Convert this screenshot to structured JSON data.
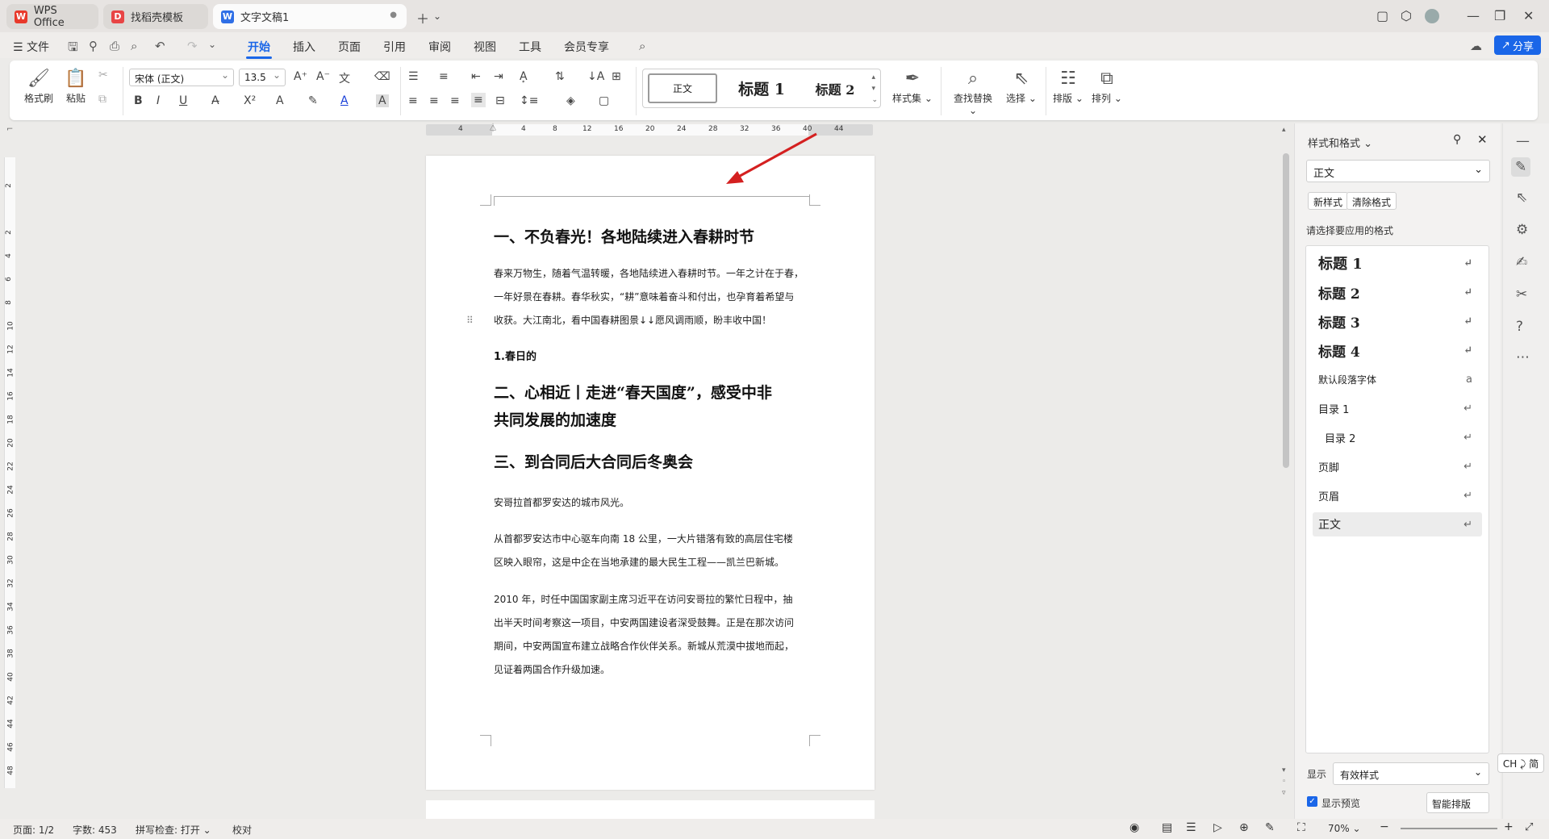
{
  "tabs": [
    {
      "label": "WPS Office",
      "icon": "wps-logo-icon"
    },
    {
      "label": "找稻壳模板",
      "icon": "docer-icon"
    },
    {
      "label": "文字文稿1",
      "icon": "writer-doc-icon"
    }
  ],
  "menubar": {
    "file": "文件",
    "items": [
      "开始",
      "插入",
      "页面",
      "引用",
      "审阅",
      "视图",
      "工具",
      "会员专享"
    ],
    "active": "开始",
    "share": "分享"
  },
  "ribbon": {
    "format_painter": "格式刷",
    "paste": "粘贴",
    "font_name": "宋体 (正文)",
    "font_size": "13.5",
    "styles": [
      "正文",
      "标题  1",
      "标题  2"
    ],
    "style_set": "样式集",
    "find_replace": "查找替换",
    "select": "选择",
    "layout": "排版",
    "arrange": "排列",
    "bold": "B",
    "italic": "I",
    "underline": "U"
  },
  "ruler": {
    "h_ticks": [
      "4",
      "4",
      "8",
      "12",
      "16",
      "20",
      "24",
      "28",
      "32",
      "36",
      "40",
      "44"
    ],
    "v_ticks": [
      "2",
      "2",
      "4",
      "6",
      "8",
      "10",
      "12",
      "14",
      "16",
      "18",
      "20",
      "22",
      "24",
      "26",
      "28",
      "30",
      "32",
      "34",
      "36",
      "38",
      "40",
      "42",
      "44",
      "46",
      "48"
    ]
  },
  "document": {
    "h1_a": "一、不负春光！各地陆续进入春耕时节",
    "p1_l1": "春来万物生，随着气温转暖，各地陆续进入春耕时节。一年之计在于春，",
    "p1_l2": "一年好景在春耕。春华秋实，“耕”意味着奋斗和付出，也孕育着希望与",
    "p1_l3": "收获。大江南北，看中国春耕图景↓↓愿风调雨顺，盼丰收中国！",
    "h4": "1.春日的",
    "h1_b_l1": "二、心相近丨走进“春天国度”，感受中非",
    "h1_b_l2": "共同发展的加速度",
    "h1_c": "三、到合同后大合同后冬奥会",
    "p2": "安哥拉首都罗安达的城市风光。",
    "p3_l1": "从首都罗安达市中心驱车向南 18 公里，一大片错落有致的高层住宅楼",
    "p3_l2": "区映入眼帘，这是中企在当地承建的最大民生工程——凯兰巴新城。",
    "p4_l1": "2010 年，时任中国国家副主席习近平在访问安哥拉的繁忙日程中，抽",
    "p4_l2": "出半天时间考察这一项目，中安两国建设者深受鼓舞。正是在那次访问",
    "p4_l3": "期间，中安两国宣布建立战略合作伙伴关系。新城从荒漠中拔地而起，",
    "p4_l4": "见证着两国合作升级加速。"
  },
  "panel": {
    "title": "样式和格式",
    "current_style": "正文",
    "new_style": "新样式",
    "clear_format": "清除格式",
    "prompt": "请选择要应用的格式",
    "styles": [
      "标题  1",
      "标题  2",
      "标题  3",
      "标题 4",
      "默认段落字体",
      "目录  1",
      "目录  2",
      "页脚",
      "页眉",
      "正文"
    ],
    "show_label": "显示",
    "show_value": "有效样式",
    "preview_label": "显示预览",
    "smart_layout": "智能排版"
  },
  "status": {
    "page": "页面: 1/2",
    "words": "字数: 453",
    "spell": "拼写检查: 打开",
    "proof": "校对",
    "zoom": "70%",
    "ime": "CH ⤸ 简"
  },
  "colors": {
    "accent": "#1a66e8",
    "arrow": "#d42020",
    "wps_red": "#e8392b"
  }
}
